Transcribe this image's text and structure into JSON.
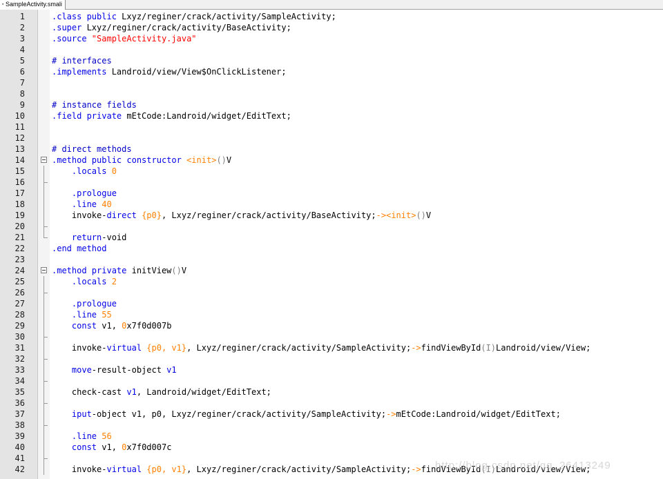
{
  "tab": {
    "label": "SampleActivity.smali"
  },
  "watermark": "http://blog.csdn.net/qq_26413249",
  "colors": {
    "keyword": "#0000e6",
    "string": "#ff0000",
    "number": "#ff8000",
    "comment": "#0000c8",
    "gutter": "#e4e4e4"
  },
  "lines": [
    {
      "n": "1",
      "fold": "",
      "segs": [
        [
          ".class ",
          "kw"
        ],
        [
          "public ",
          "kw"
        ],
        [
          "Lxyz/reginer/crack/activity/SampleActivity;",
          ""
        ]
      ]
    },
    {
      "n": "2",
      "fold": "",
      "segs": [
        [
          ".super ",
          "kw"
        ],
        [
          "Lxyz/reginer/crack/activity/BaseActivity;",
          ""
        ]
      ]
    },
    {
      "n": "3",
      "fold": "",
      "segs": [
        [
          ".source ",
          "kw"
        ],
        [
          "\"SampleActivity.java\"",
          "str"
        ]
      ]
    },
    {
      "n": "4",
      "fold": "",
      "segs": []
    },
    {
      "n": "5",
      "fold": "",
      "segs": [
        [
          "# interfaces",
          "cmt"
        ]
      ]
    },
    {
      "n": "6",
      "fold": "",
      "segs": [
        [
          ".implements ",
          "kw"
        ],
        [
          "Landroid/view/View$OnClickListener;",
          ""
        ]
      ]
    },
    {
      "n": "7",
      "fold": "",
      "segs": []
    },
    {
      "n": "8",
      "fold": "",
      "segs": []
    },
    {
      "n": "9",
      "fold": "",
      "segs": [
        [
          "# instance fields",
          "cmt"
        ]
      ]
    },
    {
      "n": "10",
      "fold": "",
      "segs": [
        [
          ".field ",
          "kw"
        ],
        [
          "private ",
          "kw"
        ],
        [
          "mEtCode:Landroid/widget/EditText;",
          ""
        ]
      ]
    },
    {
      "n": "11",
      "fold": "",
      "segs": []
    },
    {
      "n": "12",
      "fold": "",
      "segs": []
    },
    {
      "n": "13",
      "fold": "",
      "segs": [
        [
          "# direct methods",
          "cmt"
        ]
      ]
    },
    {
      "n": "14",
      "fold": "box",
      "segs": [
        [
          ".method ",
          "kw"
        ],
        [
          "public ",
          "kw"
        ],
        [
          "constructor ",
          "kw"
        ],
        [
          "<init>",
          "num"
        ],
        [
          "()",
          "t-op"
        ],
        [
          "V",
          ""
        ]
      ]
    },
    {
      "n": "15",
      "fold": "line",
      "segs": [
        [
          "    .locals ",
          "kw"
        ],
        [
          "0",
          "num"
        ]
      ]
    },
    {
      "n": "16",
      "fold": "mid",
      "segs": []
    },
    {
      "n": "17",
      "fold": "line",
      "segs": [
        [
          "    .prologue",
          "kw"
        ]
      ]
    },
    {
      "n": "18",
      "fold": "line",
      "segs": [
        [
          "    .line ",
          "kw"
        ],
        [
          "40",
          "num"
        ]
      ]
    },
    {
      "n": "19",
      "fold": "line",
      "segs": [
        [
          "    invoke-",
          ""
        ],
        [
          "direct ",
          "kw"
        ],
        [
          "{p0}",
          "num"
        ],
        [
          ", Lxyz/reginer/crack/activity/BaseActivity;",
          ""
        ],
        [
          "-><init>",
          "num"
        ],
        [
          "()",
          "t-op"
        ],
        [
          "V",
          ""
        ]
      ]
    },
    {
      "n": "20",
      "fold": "mid",
      "segs": []
    },
    {
      "n": "21",
      "fold": "end",
      "segs": [
        [
          "    return",
          "kw"
        ],
        [
          "-void",
          ""
        ]
      ]
    },
    {
      "n": "22",
      "fold": "",
      "segs": [
        [
          ".end ",
          "kw"
        ],
        [
          "method",
          "kw"
        ]
      ]
    },
    {
      "n": "23",
      "fold": "",
      "segs": []
    },
    {
      "n": "24",
      "fold": "box",
      "segs": [
        [
          ".method ",
          "kw"
        ],
        [
          "private ",
          "kw"
        ],
        [
          "initView",
          ""
        ],
        [
          "()",
          "t-op"
        ],
        [
          "V",
          ""
        ]
      ]
    },
    {
      "n": "25",
      "fold": "line",
      "segs": [
        [
          "    .locals ",
          "kw"
        ],
        [
          "2",
          "num"
        ]
      ]
    },
    {
      "n": "26",
      "fold": "mid",
      "segs": []
    },
    {
      "n": "27",
      "fold": "line",
      "segs": [
        [
          "    .prologue",
          "kw"
        ]
      ]
    },
    {
      "n": "28",
      "fold": "line",
      "segs": [
        [
          "    .line ",
          "kw"
        ],
        [
          "55",
          "num"
        ]
      ]
    },
    {
      "n": "29",
      "fold": "line",
      "segs": [
        [
          "    const ",
          "kw"
        ],
        [
          "v1, ",
          ""
        ],
        [
          "0",
          "num"
        ],
        [
          "x7f0d007b",
          ""
        ]
      ]
    },
    {
      "n": "30",
      "fold": "mid",
      "segs": []
    },
    {
      "n": "31",
      "fold": "line",
      "segs": [
        [
          "    invoke-",
          ""
        ],
        [
          "virtual ",
          "kw"
        ],
        [
          "{p0, v1}",
          "num"
        ],
        [
          ", Lxyz/reginer/crack/activity/SampleActivity;",
          ""
        ],
        [
          "->",
          "num"
        ],
        [
          "findViewById",
          ""
        ],
        [
          "(I)",
          "t-op"
        ],
        [
          "Landroid/view/View;",
          ""
        ]
      ]
    },
    {
      "n": "32",
      "fold": "mid",
      "segs": []
    },
    {
      "n": "33",
      "fold": "line",
      "segs": [
        [
          "    move",
          "kw"
        ],
        [
          "-result-object ",
          ""
        ],
        [
          "v1",
          "kw"
        ]
      ]
    },
    {
      "n": "34",
      "fold": "mid",
      "segs": []
    },
    {
      "n": "35",
      "fold": "line",
      "segs": [
        [
          "    check-cast ",
          ""
        ],
        [
          "v1",
          "kw"
        ],
        [
          ", Landroid/widget/EditText;",
          ""
        ]
      ]
    },
    {
      "n": "36",
      "fold": "mid",
      "segs": []
    },
    {
      "n": "37",
      "fold": "line",
      "segs": [
        [
          "    iput",
          "kw"
        ],
        [
          "-object v1, p0, Lxyz/reginer/crack/activity/SampleActivity;",
          ""
        ],
        [
          "->",
          "num"
        ],
        [
          "mEtCode:Landroid/widget/EditText;",
          ""
        ]
      ]
    },
    {
      "n": "38",
      "fold": "mid",
      "segs": []
    },
    {
      "n": "39",
      "fold": "line",
      "segs": [
        [
          "    .line ",
          "kw"
        ],
        [
          "56",
          "num"
        ]
      ]
    },
    {
      "n": "40",
      "fold": "line",
      "segs": [
        [
          "    const ",
          "kw"
        ],
        [
          "v1, ",
          ""
        ],
        [
          "0",
          "num"
        ],
        [
          "x7f0d007c",
          ""
        ]
      ]
    },
    {
      "n": "41",
      "fold": "mid",
      "segs": []
    },
    {
      "n": "42",
      "fold": "line",
      "segs": [
        [
          "    invoke-",
          ""
        ],
        [
          "virtual ",
          "kw"
        ],
        [
          "{p0, v1}",
          "num"
        ],
        [
          ", Lxyz/reginer/crack/activity/SampleActivity;",
          ""
        ],
        [
          "->",
          "num"
        ],
        [
          "findViewById",
          ""
        ],
        [
          "(I)",
          "t-op"
        ],
        [
          "Landroid/view/View;",
          ""
        ]
      ]
    }
  ]
}
